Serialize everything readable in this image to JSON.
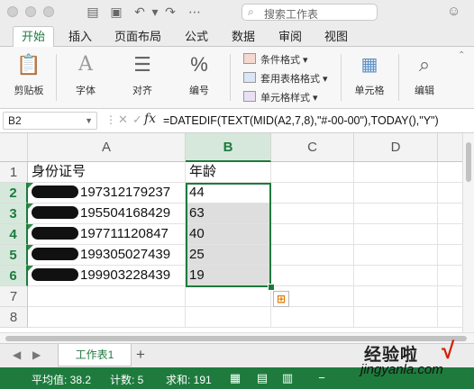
{
  "app": {
    "search_placeholder": "搜索工作表",
    "tabs": [
      {
        "label": "开始",
        "active": true
      },
      {
        "label": "插入"
      },
      {
        "label": "页面布局"
      },
      {
        "label": "公式"
      },
      {
        "label": "数据"
      },
      {
        "label": "审阅"
      },
      {
        "label": "视图"
      }
    ]
  },
  "ribbon": {
    "groups": [
      {
        "label": "剪贴板",
        "icon": "clipboard-icon"
      },
      {
        "label": "字体",
        "icon": "font-icon"
      },
      {
        "label": "对齐",
        "icon": "align-icon"
      },
      {
        "label": "编号",
        "icon": "percent-icon"
      },
      {
        "label": "单元格",
        "icon": "cells-icon"
      },
      {
        "label": "编辑",
        "icon": "search-icon"
      }
    ],
    "styles": [
      {
        "label": "条件格式 ▾"
      },
      {
        "label": "套用表格格式 ▾"
      },
      {
        "label": "单元格样式 ▾"
      }
    ]
  },
  "formula_bar": {
    "name_box": "B2",
    "fx": "fx",
    "formula": "=DATEDIF(TEXT(MID(A2,7,8),\"#-00-00\"),TODAY(),\"Y\")"
  },
  "sheet": {
    "columns": [
      "A",
      "B",
      "C",
      "D"
    ],
    "rows": [
      "1",
      "2",
      "3",
      "4",
      "5",
      "6",
      "7",
      "8"
    ],
    "header_row": {
      "a": "身份证号",
      "b": "年龄"
    },
    "data": [
      {
        "id_visible": "197312179237",
        "age": "44"
      },
      {
        "id_visible": "195504168429",
        "age": "63"
      },
      {
        "id_visible": "197711120847",
        "age": "40"
      },
      {
        "id_visible": "199305027439",
        "age": "25"
      },
      {
        "id_visible": "199903228439",
        "age": "19"
      }
    ]
  },
  "sheet_tabs": {
    "active": "工作表1",
    "add": "+"
  },
  "status_bar": {
    "average": "平均值: 38.2",
    "count": "计数: 5",
    "sum": "求和: 191"
  },
  "watermark": {
    "title": "经验啦",
    "url": "jingyanla.com"
  },
  "colors": {
    "accent": "#1d7a3e",
    "status_bg": "#1e7b3d",
    "selection_fill": "#dedede"
  }
}
